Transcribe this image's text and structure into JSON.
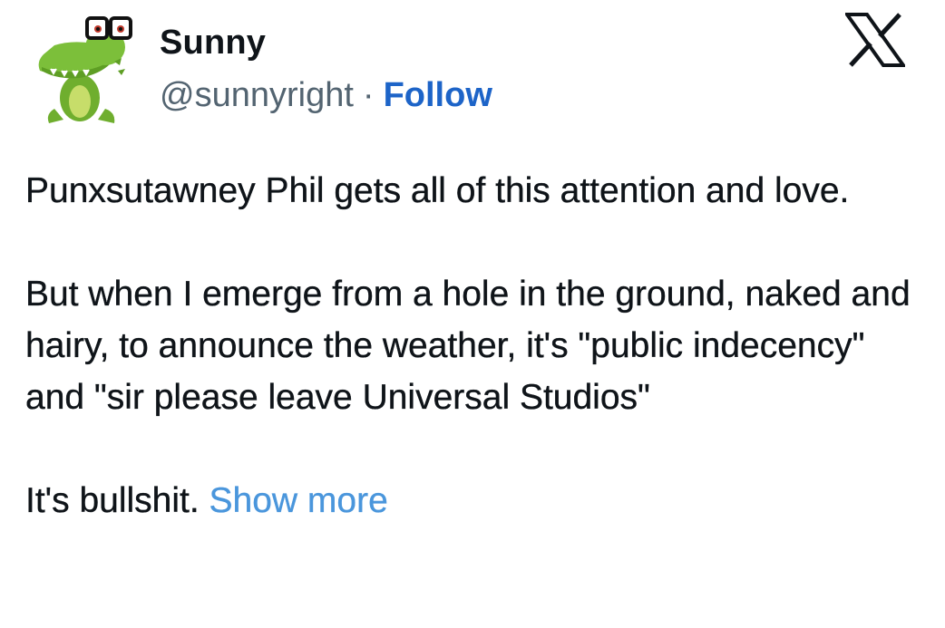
{
  "colors": {
    "text": "#0f1419",
    "secondary": "#536471",
    "follow": "#1d64c8",
    "show_more": "#4a96dc",
    "avatar_green": "#7cbf3a"
  },
  "author": {
    "name": "Sunny",
    "handle": "@sunnyright",
    "separator": "·",
    "follow_label": "Follow",
    "avatar_icon": "cartoon-crocodile-with-glasses"
  },
  "header": {
    "logo_icon": "x-logo-icon"
  },
  "tweet": {
    "paragraph_1": "Punxsutawney Phil gets all of this attention and love.",
    "paragraph_2": "But when I emerge from a hole in the ground, naked and hairy, to announce the weather, it's \"public indecency\" and \"sir please leave Universal Studios\"",
    "paragraph_3": "It's bullshit.",
    "show_more_label": "Show more"
  }
}
